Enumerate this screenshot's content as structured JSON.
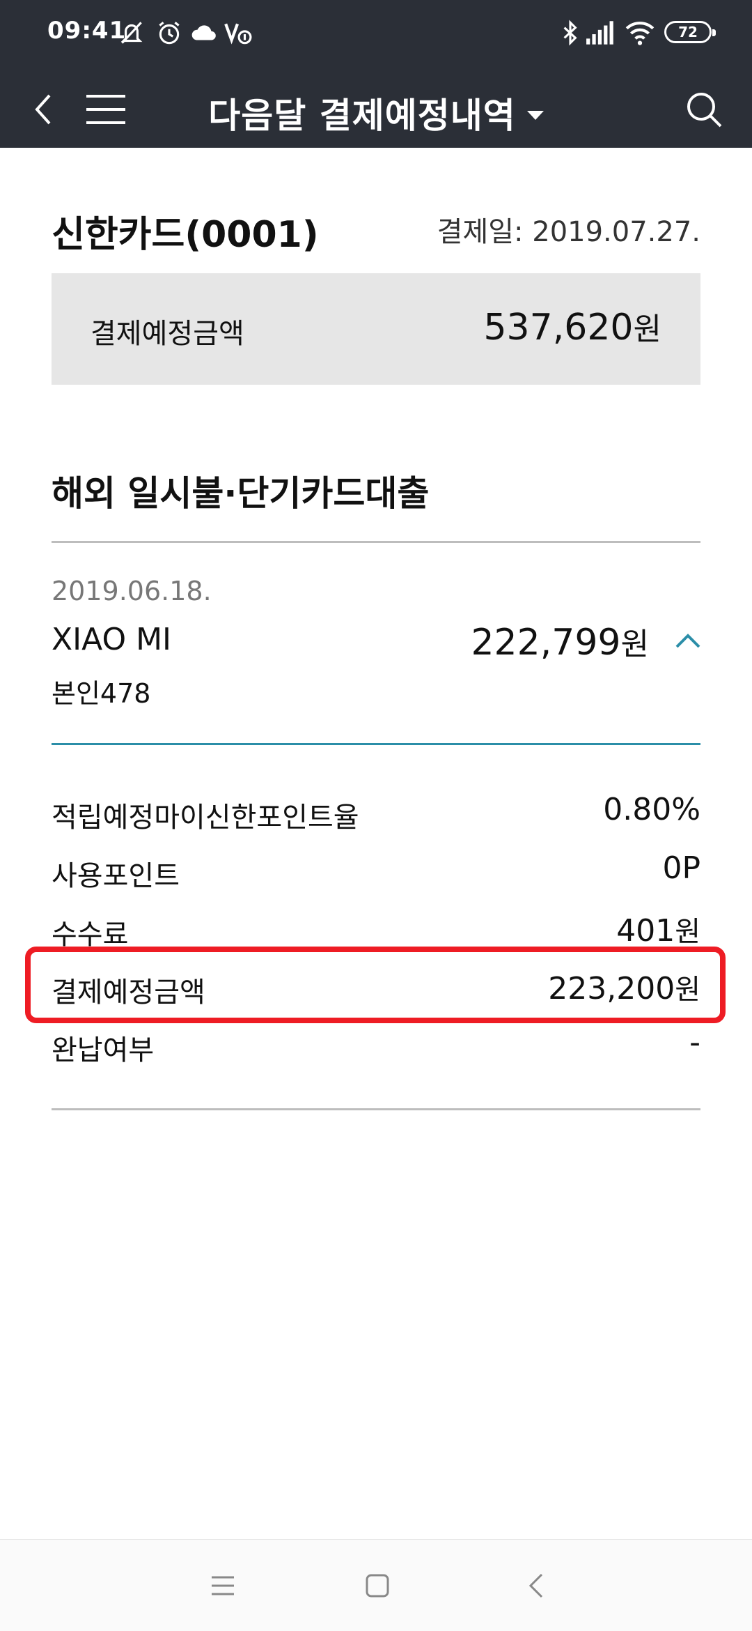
{
  "status_bar": {
    "time": "09:41",
    "battery": "72",
    "icons": [
      "mute-icon",
      "alarm-icon",
      "cloud-icon",
      "volte-icon",
      "bluetooth-icon",
      "signal-icon",
      "wifi-icon",
      "battery-icon"
    ]
  },
  "header": {
    "title": "다음달 결제예정내역",
    "back_icon": "back-arrow-icon",
    "menu_icon": "hamburger-menu-icon",
    "search_icon": "search-icon",
    "background": "#2b2f37"
  },
  "card": {
    "name": "신한카드(0001)",
    "payment_date": "결제일: 2019.07.27.",
    "summary_label": "결제예정금액",
    "summary_amount": "537,620",
    "currency_unit": "원"
  },
  "section": {
    "title": "해외 일시불·단기카드대출"
  },
  "transaction": {
    "date": "2019.06.18.",
    "merchant": "XIAO MI",
    "amount": "222,799",
    "currency_unit": "원",
    "holder": "본인478",
    "expanded": true,
    "toggle_icon": "chevron-up-icon"
  },
  "details": [
    {
      "label": "적립예정마이신한포인트율",
      "value": "0.80%",
      "unit": ""
    },
    {
      "label": "사용포인트",
      "value": "0P",
      "unit": ""
    },
    {
      "label": "수수료",
      "value": "401",
      "unit": "원"
    },
    {
      "label": "결제예정금액",
      "value": "223,200",
      "unit": "원"
    },
    {
      "label": "완납여부",
      "value": "-",
      "unit": ""
    }
  ],
  "highlight": {
    "color": "#ee1c24",
    "target_row": "결제예정금액"
  },
  "colors": {
    "accent": "#2b8ea8",
    "summary_bg": "#e6e6e6"
  },
  "system_nav": [
    "recents-icon",
    "home-icon",
    "back-icon"
  ]
}
